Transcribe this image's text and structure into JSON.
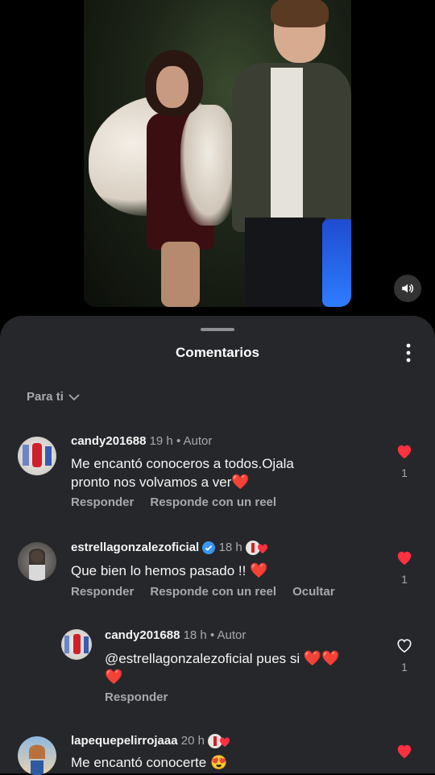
{
  "sheet": {
    "title": "Comentarios",
    "filter_label": "Para ti"
  },
  "comments": [
    {
      "username": "candy201688",
      "time": "19 h",
      "tag": "• Autor",
      "text_line1": "Me encantó conoceros a todos.Ojala",
      "text_line2": "pronto nos volvamos a ver",
      "reply_label": "Responder",
      "reel_label": "Responde con un reel",
      "like_count": "1"
    },
    {
      "username": "estrellagonzalezoficial",
      "time": "18 h",
      "text": "Que bien lo hemos pasado !!",
      "reply_label": "Responder",
      "reel_label": "Responde con un reel",
      "hide_label": "Ocultar",
      "like_count": "1"
    },
    {
      "username": "candy201688",
      "time": "18 h",
      "tag": "• Autor",
      "text": "@estrellagonzalezoficial pues si",
      "reply_label": "Responder",
      "like_count": "1"
    },
    {
      "username": "lapequepelirrojaaa",
      "time": "20 h",
      "text": "Me encantó conocerte"
    }
  ],
  "colors": {
    "heart": "#ff3040",
    "sheet_bg": "#26272b",
    "verified": "#3897f0"
  },
  "icons": [
    "speaker-icon",
    "more-vertical-icon",
    "chevron-down-icon",
    "heart-icon",
    "heart-outline-icon",
    "verified-icon",
    "emoji-heart-eyes-icon"
  ]
}
